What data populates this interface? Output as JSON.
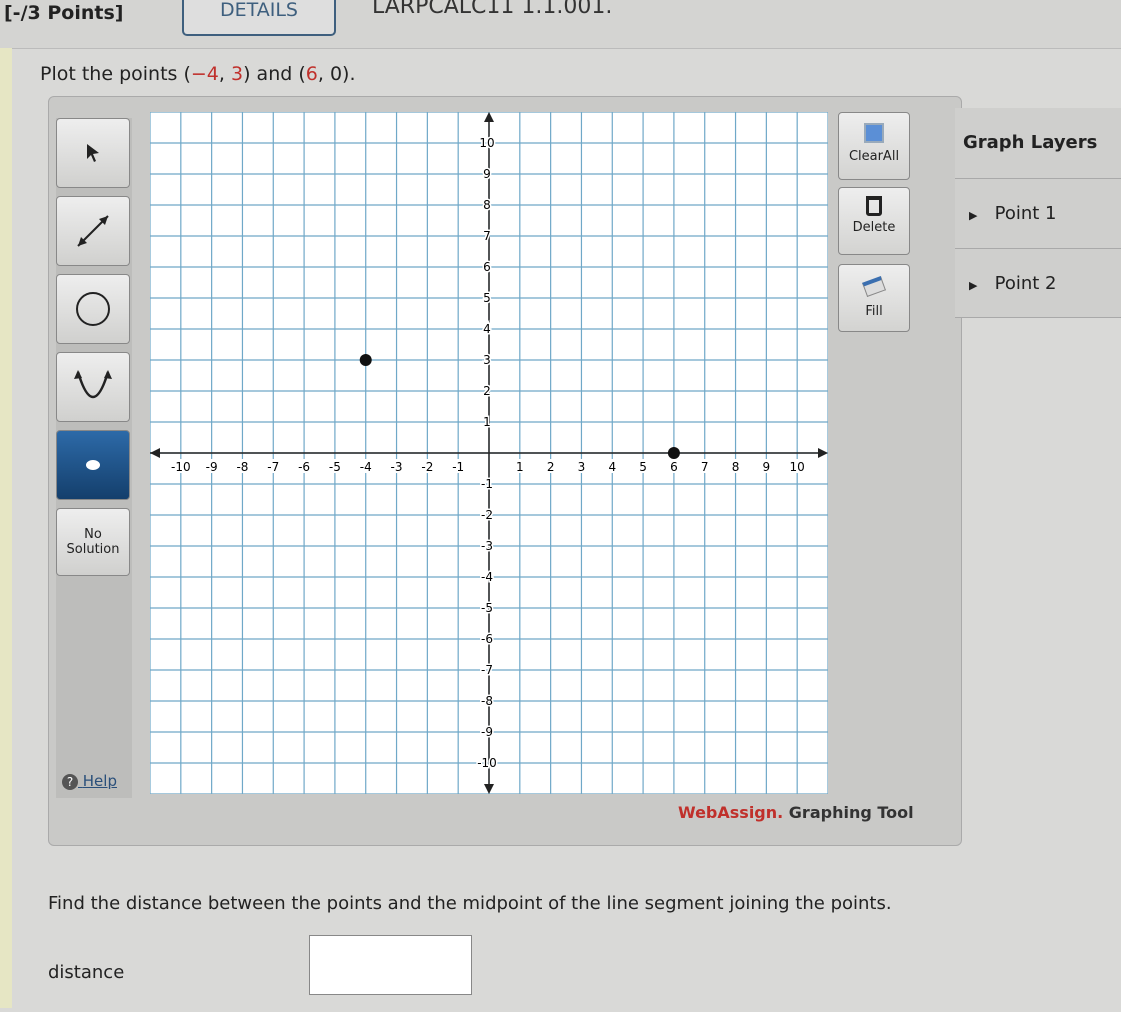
{
  "header": {
    "points": "[-/3 Points]",
    "details": "DETAILS",
    "code": "LARPCALC11 1.1.001."
  },
  "prompt": {
    "pre": "Plot the points (",
    "p1x": "−4",
    "sep1": ", ",
    "p1y": "3",
    "mid": ") and (",
    "p2x": "6",
    "sep2": ", ",
    "p2y": "0",
    "post": ")."
  },
  "toolbar": {
    "tools": [
      "pointer-icon",
      "line-icon",
      "circle-icon",
      "parabola-icon",
      "point-icon"
    ],
    "active": "point-icon",
    "no_solution": "No Solution",
    "help": "Help"
  },
  "right_buttons": {
    "clear_all": "ClearAll",
    "delete": "Delete",
    "fill": "Fill"
  },
  "layers": {
    "title": "Graph Layers",
    "items": [
      "Point 1",
      "Point 2"
    ]
  },
  "graph": {
    "xlim": [
      -11,
      11
    ],
    "ylim": [
      -11,
      11
    ],
    "labeled_ticks": [
      -10,
      -9,
      -8,
      -7,
      -6,
      -5,
      -4,
      -3,
      -2,
      -1,
      1,
      2,
      3,
      4,
      5,
      6,
      7,
      8,
      9,
      10
    ],
    "grid": true,
    "points": [
      {
        "x": -4,
        "y": 3
      },
      {
        "x": 6,
        "y": 0
      }
    ],
    "grid_color": "#6fa8c8",
    "point_color": "#111111"
  },
  "credit": {
    "brand": "WebAssign.",
    "rest": " Graphing Tool"
  },
  "question": {
    "text": "Find the distance between the points and the midpoint of the line segment joining the points.",
    "distance_label": "distance",
    "distance_value": ""
  }
}
